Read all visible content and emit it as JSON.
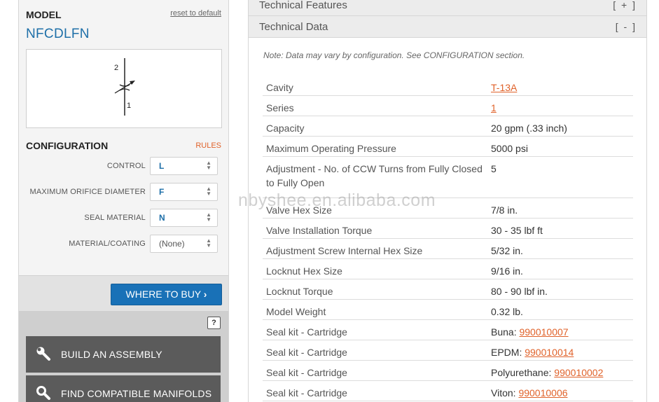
{
  "model": {
    "label": "MODEL",
    "reset_label": "reset to default",
    "name": "NFCDLFN",
    "symbol_port_top": "2",
    "symbol_port_bottom": "1"
  },
  "configuration": {
    "label": "CONFIGURATION",
    "rules_label": "RULES",
    "options": [
      {
        "name": "CONTROL",
        "value": "L"
      },
      {
        "name": "MAXIMUM ORIFICE DIAMETER",
        "value": "F"
      },
      {
        "name": "SEAL MATERIAL",
        "value": "N"
      },
      {
        "name": "MATERIAL/COATING",
        "value": "(None)"
      }
    ]
  },
  "actions": {
    "where_to_buy": "WHERE TO BUY",
    "help": "?",
    "build_assembly": "BUILD AN ASSEMBLY",
    "find_manifolds": "FIND COMPATIBLE MANIFOLDS"
  },
  "accordion": {
    "features_title": "Technical Features",
    "features_toggle": "[ + ]",
    "data_title": "Technical Data",
    "data_toggle": "[ - ]"
  },
  "note": "Note: Data may vary by configuration. See CONFIGURATION section.",
  "technical_data": [
    {
      "label": "Cavity",
      "value": "",
      "link": "T-13A"
    },
    {
      "label": "Series",
      "value": "",
      "link": "1"
    },
    {
      "label": "Capacity",
      "value": "20 gpm (.33 inch)",
      "link": ""
    },
    {
      "label": "Maximum Operating Pressure",
      "value": "5000 psi",
      "link": ""
    },
    {
      "label": "Adjustment - No. of CCW Turns from Fully Closed to Fully Open",
      "value": "5",
      "link": ""
    },
    {
      "label": "Valve Hex Size",
      "value": "7/8 in.",
      "link": ""
    },
    {
      "label": "Valve Installation Torque",
      "value": "30 - 35 lbf ft",
      "link": ""
    },
    {
      "label": "Adjustment Screw Internal Hex Size",
      "value": "5/32 in.",
      "link": ""
    },
    {
      "label": "Locknut Hex Size",
      "value": "9/16 in.",
      "link": ""
    },
    {
      "label": "Locknut Torque",
      "value": "80 - 90 lbf in.",
      "link": ""
    },
    {
      "label": "Model Weight",
      "value": "0.32 lb.",
      "link": ""
    },
    {
      "label": "Seal kit - Cartridge",
      "value": "Buna: ",
      "link": "990010007"
    },
    {
      "label": "Seal kit - Cartridge",
      "value": "EPDM: ",
      "link": "990010014"
    },
    {
      "label": "Seal kit - Cartridge",
      "value": "Polyurethane: ",
      "link": "990010002"
    },
    {
      "label": "Seal kit - Cartridge",
      "value": "Viton: ",
      "link": "990010006"
    }
  ],
  "watermark": "nbyshee.en.alibaba.com",
  "colors": {
    "accent_blue": "#1e6fa8",
    "button_blue": "#1971b7",
    "link_orange": "#e0622a",
    "tool_button": "#5b5b5b"
  }
}
